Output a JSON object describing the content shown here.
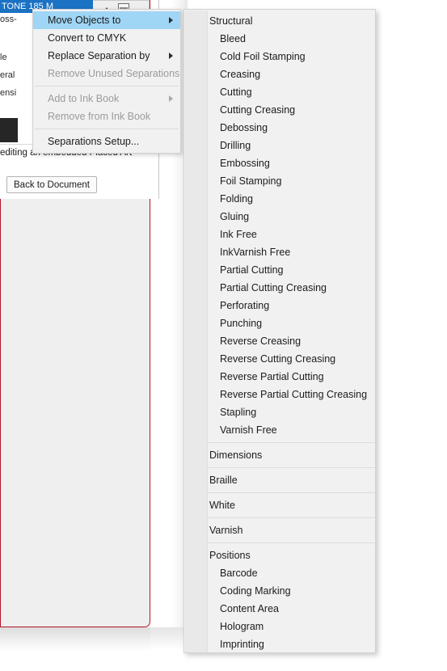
{
  "panel": {
    "title": "TONE 185 M",
    "sub_label": "oss-",
    "list_items": [
      "le",
      "eral",
      "ensi"
    ],
    "note": "editing an embedded Placed Art",
    "back_button": "Back to Document"
  },
  "context_menu": {
    "items": [
      {
        "label": "Move Objects to",
        "submenu": true,
        "disabled": false,
        "selected": true,
        "separator_after": false
      },
      {
        "label": "Convert to CMYK",
        "submenu": false,
        "disabled": false,
        "selected": false,
        "separator_after": false
      },
      {
        "label": "Replace Separation by",
        "submenu": true,
        "disabled": false,
        "selected": false,
        "separator_after": false
      },
      {
        "label": "Remove Unused Separations",
        "submenu": false,
        "disabled": true,
        "selected": false,
        "separator_after": true
      },
      {
        "label": "Add to Ink Book",
        "submenu": true,
        "disabled": true,
        "selected": false,
        "separator_after": false
      },
      {
        "label": "Remove from Ink Book",
        "submenu": false,
        "disabled": true,
        "selected": false,
        "separator_after": true
      },
      {
        "label": "Separations Setup...",
        "submenu": false,
        "disabled": false,
        "selected": false,
        "separator_after": false
      }
    ]
  },
  "submenu": {
    "items": [
      {
        "label": "Structural",
        "group": true,
        "separator_after": false
      },
      {
        "label": "Bleed",
        "group": false,
        "separator_after": false
      },
      {
        "label": "Cold Foil Stamping",
        "group": false,
        "separator_after": false
      },
      {
        "label": "Creasing",
        "group": false,
        "separator_after": false
      },
      {
        "label": "Cutting",
        "group": false,
        "separator_after": false
      },
      {
        "label": "Cutting Creasing",
        "group": false,
        "separator_after": false
      },
      {
        "label": "Debossing",
        "group": false,
        "separator_after": false
      },
      {
        "label": "Drilling",
        "group": false,
        "separator_after": false
      },
      {
        "label": "Embossing",
        "group": false,
        "separator_after": false
      },
      {
        "label": "Foil Stamping",
        "group": false,
        "separator_after": false
      },
      {
        "label": "Folding",
        "group": false,
        "separator_after": false
      },
      {
        "label": "Gluing",
        "group": false,
        "separator_after": false
      },
      {
        "label": "Ink Free",
        "group": false,
        "separator_after": false
      },
      {
        "label": "InkVarnish Free",
        "group": false,
        "separator_after": false
      },
      {
        "label": "Partial Cutting",
        "group": false,
        "separator_after": false
      },
      {
        "label": "Partial Cutting Creasing",
        "group": false,
        "separator_after": false
      },
      {
        "label": "Perforating",
        "group": false,
        "separator_after": false
      },
      {
        "label": "Punching",
        "group": false,
        "separator_after": false
      },
      {
        "label": "Reverse Creasing",
        "group": false,
        "separator_after": false
      },
      {
        "label": "Reverse Cutting Creasing",
        "group": false,
        "separator_after": false
      },
      {
        "label": "Reverse Partial Cutting",
        "group": false,
        "separator_after": false
      },
      {
        "label": "Reverse Partial Cutting Creasing",
        "group": false,
        "separator_after": false
      },
      {
        "label": "Stapling",
        "group": false,
        "separator_after": false
      },
      {
        "label": "Varnish Free",
        "group": false,
        "separator_after": true
      },
      {
        "label": "Dimensions",
        "group": true,
        "separator_after": true
      },
      {
        "label": "Braille",
        "group": true,
        "separator_after": true
      },
      {
        "label": "White",
        "group": true,
        "separator_after": true
      },
      {
        "label": "Varnish",
        "group": true,
        "separator_after": true
      },
      {
        "label": "Positions",
        "group": true,
        "separator_after": false
      },
      {
        "label": "Barcode",
        "group": false,
        "separator_after": false
      },
      {
        "label": "Coding Marking",
        "group": false,
        "separator_after": false
      },
      {
        "label": "Content Area",
        "group": false,
        "separator_after": false
      },
      {
        "label": "Hologram",
        "group": false,
        "separator_after": false
      },
      {
        "label": "Imprinting",
        "group": false,
        "separator_after": false
      }
    ]
  },
  "colors": {
    "menu_bg": "#f1f1f1",
    "highlight": "#9fd5f5",
    "titlebar": "#1b72c4",
    "artboard_border": "#b4142c",
    "disabled_text": "#9b9b9b"
  }
}
